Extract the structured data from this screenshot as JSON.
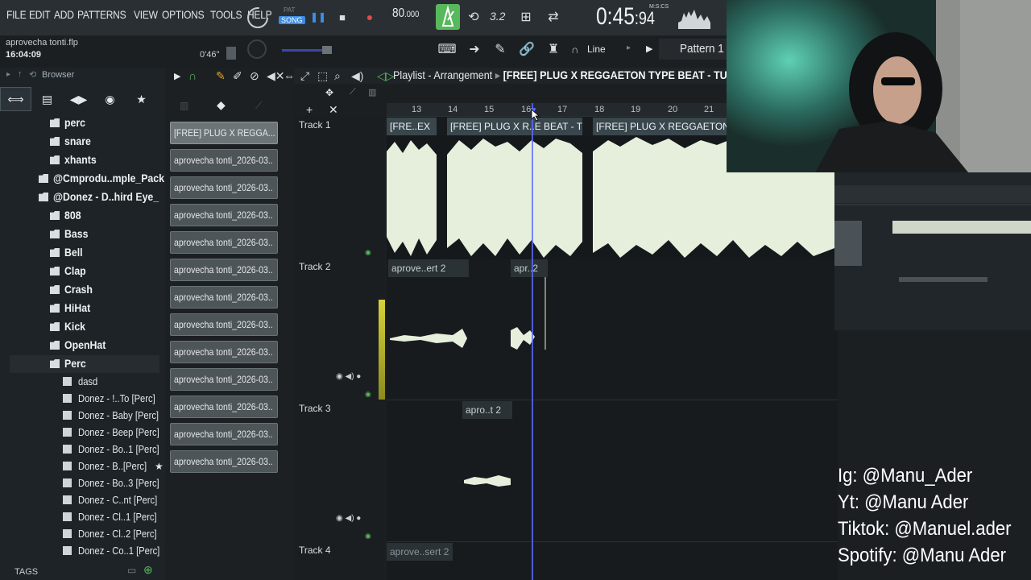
{
  "menu": [
    "FILE",
    "EDIT",
    "ADD",
    "PATTERNS",
    "VIEW",
    "OPTIONS",
    "TOOLS",
    "HELP"
  ],
  "transport": {
    "pat_label": "PAT",
    "song_label": "SONG",
    "tempo": "80",
    "tempo_frac": ".000",
    "snap_value": "3.2",
    "time": "0:45",
    "time_cs": ":94",
    "time_format": "M:S:CS"
  },
  "file": {
    "name": "aprovecha tonti.flp",
    "time": "16:04:09"
  },
  "pitch_label": "0'46\"",
  "snap_mode": "Line",
  "pattern_selector": "Pattern 1",
  "browser": {
    "title": "Browser",
    "folders_top": [
      "perc",
      "snare",
      "xhants"
    ],
    "packs": [
      "@Cmprodu..mple_Pack",
      "@Donez - D..hird Eye_"
    ],
    "subfolders": [
      "808",
      "Bass",
      "Bell",
      "Clap",
      "Crash",
      "HiHat",
      "Kick",
      "OpenHat",
      "Perc"
    ],
    "files": [
      "dasd",
      "Donez - !..To [Perc]",
      "Donez - Baby [Perc]",
      "Donez - Beep [Perc]",
      "Donez - Bo..1 [Perc]",
      "Donez - B..[Perc]",
      "Donez - Bo..3 [Perc]",
      "Donez - C..nt [Perc]",
      "Donez - Cl..1 [Perc]",
      "Donez - Cl..2 [Perc]",
      "Donez - Co..1 [Perc]"
    ],
    "tags_label": "TAGS"
  },
  "picker": {
    "items": [
      "[FREE] PLUG X REGGA...",
      "aprovecha tonti_2026-03..",
      "aprovecha tonti_2026-03..",
      "aprovecha tonti_2026-03..",
      "aprovecha tonti_2026-03..",
      "aprovecha tonti_2026-03..",
      "aprovecha tonti_2026-03..",
      "aprovecha tonti_2026-03..",
      "aprovecha tonti_2026-03..",
      "aprovecha tonti_2026-03..",
      "aprovecha tonti_2026-03..",
      "aprovecha tonti_2026-03.."
    ]
  },
  "playlist": {
    "title": "Playlist - Arrangement",
    "pattern_name": "[FREE] PLUG X REGGAETON TYPE BEAT - TU",
    "ruler": [
      "13",
      "14",
      "15",
      "16",
      "17",
      "18",
      "19",
      "20",
      "21"
    ],
    "tracks": [
      "Track 1",
      "Track 2",
      "Track 3",
      "Track 4"
    ],
    "clips": {
      "t1a": "[FRE..EX",
      "t1b": "[FREE] PLUG X R..E BEAT - TU EX",
      "t1c": "[FREE] PLUG X REGGAETON T",
      "t2a": "aprove..ert 2",
      "t2b": "apr..2",
      "t3a": "apro..t 2",
      "t4a": "aprove..sert 2"
    }
  },
  "socials": [
    "Ig: @Manu_Ader",
    "Yt: @Manu Ader",
    "Tiktok: @Manuel.ader",
    "Spotify: @Manu Ader"
  ],
  "colors": {
    "accent": "#58b85c",
    "waveform": "#e6efdc",
    "playhead": "#5d6cff"
  }
}
